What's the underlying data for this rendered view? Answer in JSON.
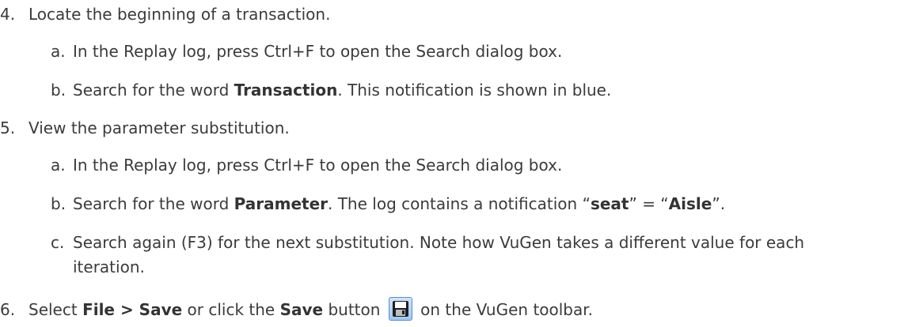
{
  "steps": [
    {
      "num": "4.",
      "text": "Locate the beginning of a transaction.",
      "subs": [
        {
          "letter": "a.",
          "text": "In the Replay log, press Ctrl+F to open the Search dialog box."
        },
        {
          "letter": "b.",
          "pre": "Search for the word ",
          "bold": "Transaction",
          "post": ". This notification is shown in blue."
        }
      ]
    },
    {
      "num": "5.",
      "text": "View the parameter substitution.",
      "subs": [
        {
          "letter": "a.",
          "text": "In the Replay log, press Ctrl+F to open the Search dialog box."
        },
        {
          "letter": "b.",
          "pre": "Search for the word ",
          "bold": "Parameter",
          "mid1": ". The log contains a notification “",
          "bold2": "seat",
          "mid2": "” = “",
          "bold3": "Aisle",
          "post": "”."
        },
        {
          "letter": "c.",
          "line1": "Search again (F3) for the next substitution. Note how VuGen takes a different value for each",
          "line2": "iteration."
        }
      ]
    },
    {
      "num": "6.",
      "pre": "Select ",
      "bold1": "File > Save",
      "mid": " or click the ",
      "bold2": "Save",
      "mid2": " button ",
      "post": " on the VuGen toolbar.",
      "icon": "save-icon"
    }
  ]
}
